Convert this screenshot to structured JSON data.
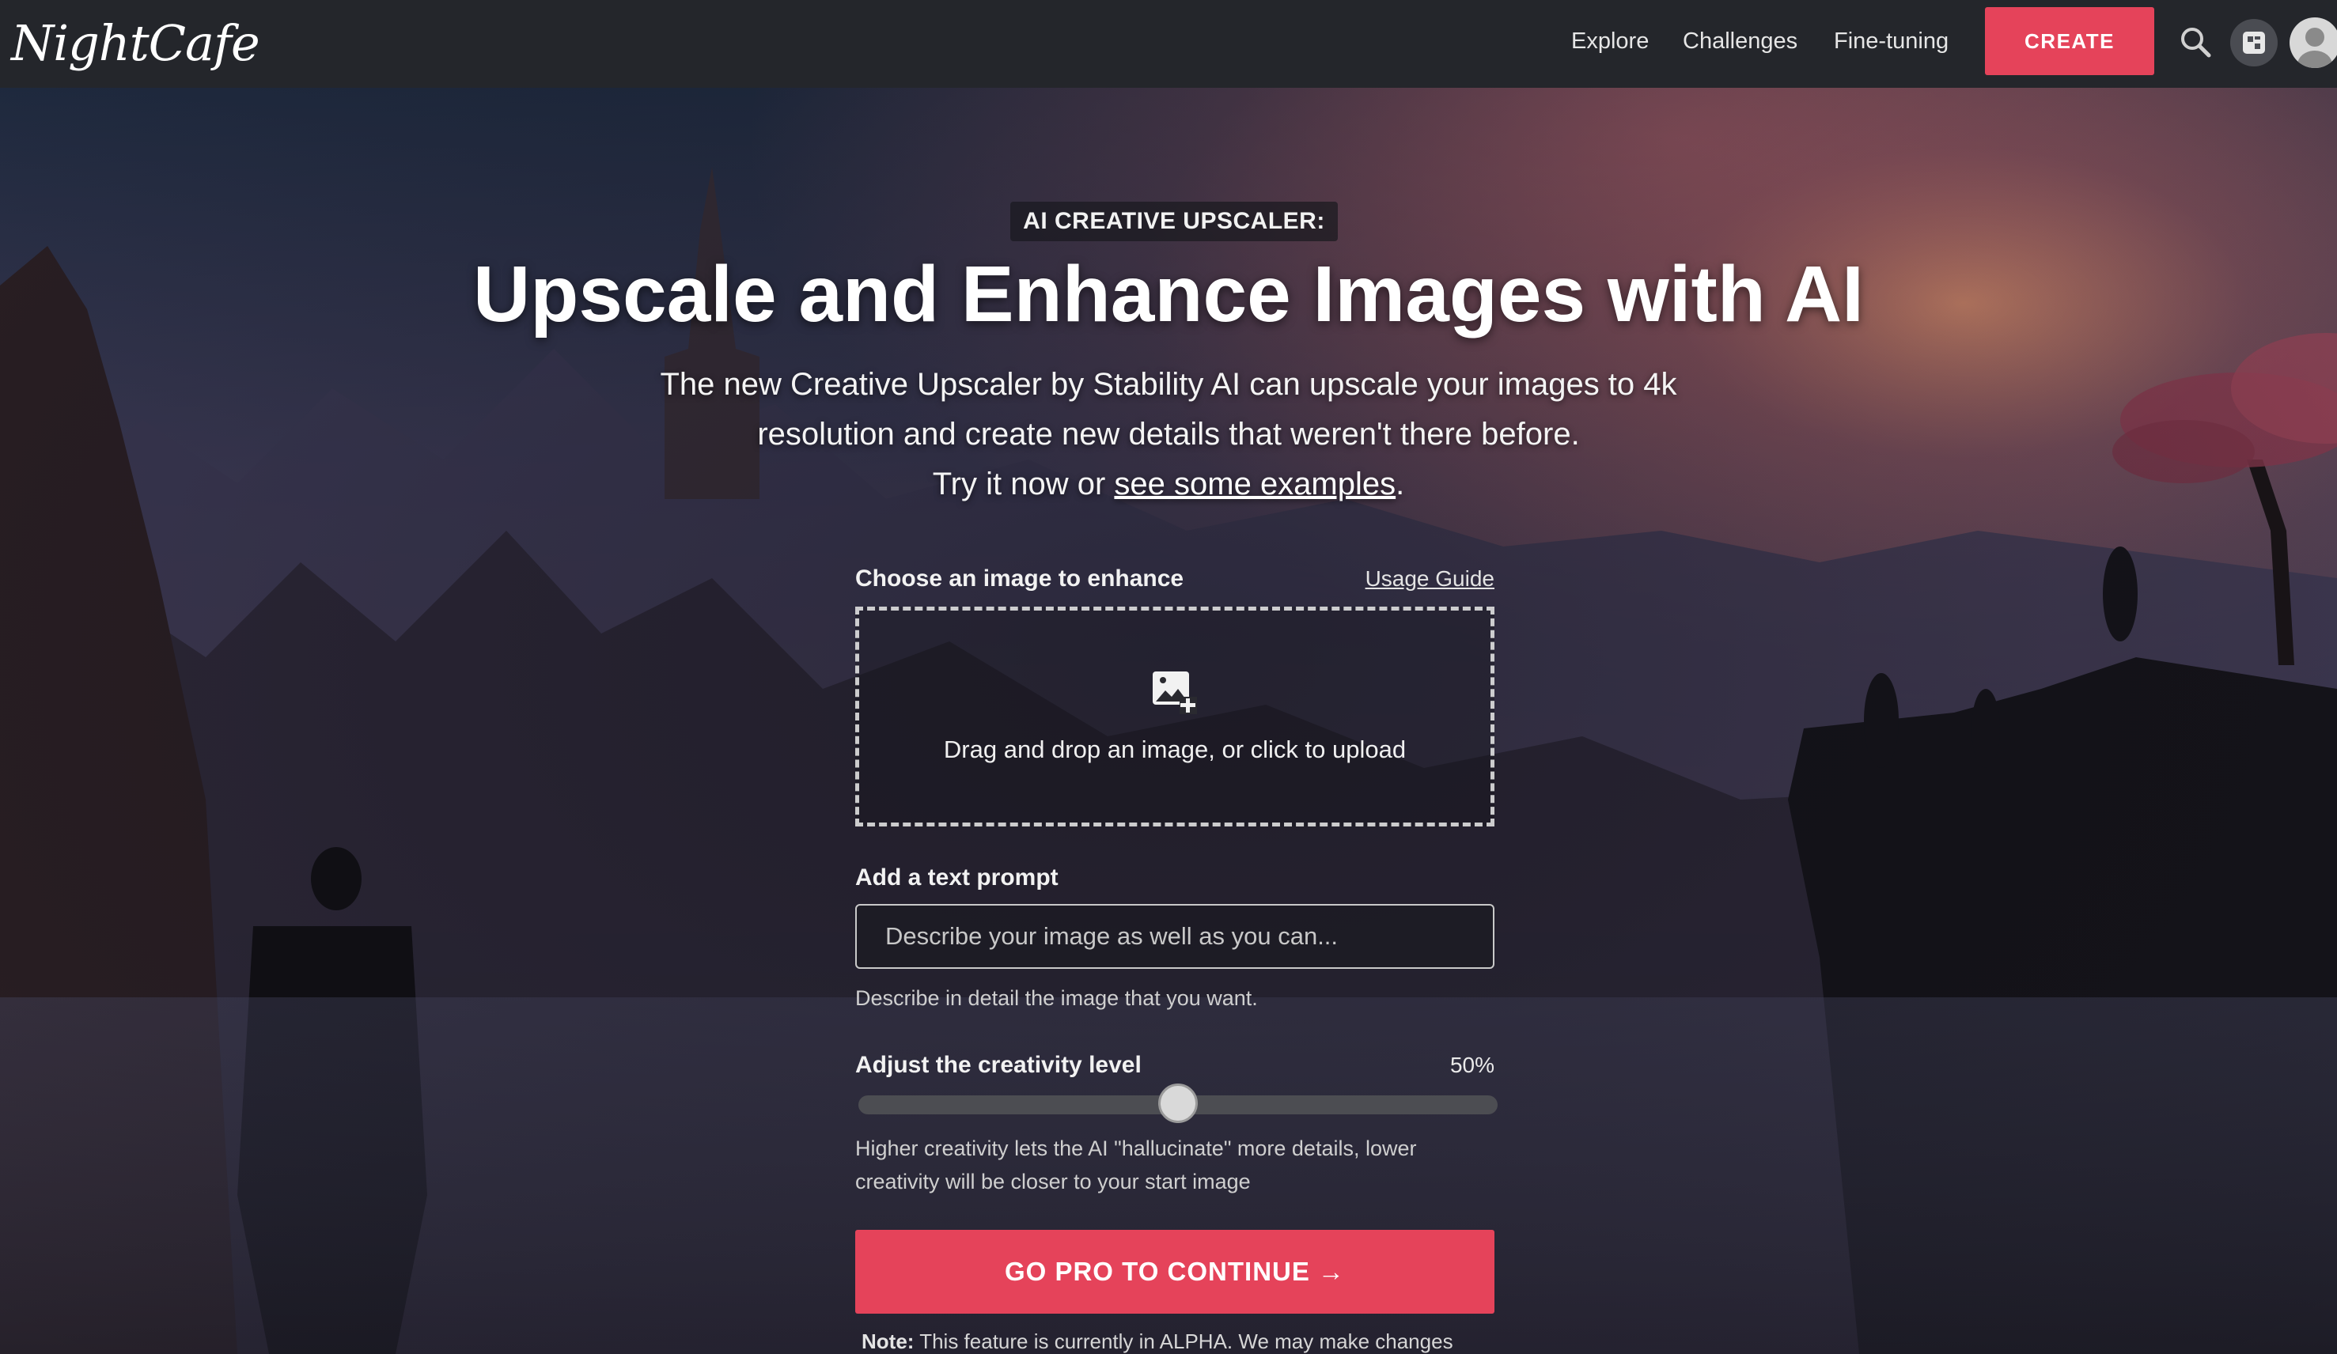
{
  "nav": {
    "logo": "NightCafe",
    "links": [
      "Explore",
      "Challenges",
      "Fine-tuning"
    ],
    "create_label": "CREATE"
  },
  "hero": {
    "eyebrow": "AI CREATIVE UPSCALER:",
    "title": "Upscale and Enhance Images with AI",
    "subtitle_line1": "The new Creative Upscaler by Stability AI can upscale your images to 4k",
    "subtitle_line2": "resolution and create new details that weren't there before.",
    "subtitle_line3_prefix": "Try it now or ",
    "subtitle_link": "see some examples",
    "subtitle_line3_suffix": "."
  },
  "form": {
    "image_label": "Choose an image to enhance",
    "usage_guide": "Usage Guide",
    "dropzone_text": "Drag and drop an image, or click to upload",
    "prompt_label": "Add a text prompt",
    "prompt_placeholder": "Describe your image as well as you can...",
    "prompt_help": "Describe in detail the image that you want.",
    "creativity_label": "Adjust the creativity level",
    "creativity_value": 50,
    "creativity_value_text": "50%",
    "creativity_help": "Higher creativity lets the AI \"hallucinate\" more details, lower creativity will be closer to your start image",
    "submit_label": "GO PRO TO CONTINUE →",
    "note_label": "Note:",
    "note_text": "This feature is currently in ALPHA. We may make changes"
  },
  "colors": {
    "accent": "#e5435a",
    "nav_bg": "#24262b"
  },
  "icons": [
    "search-icon",
    "coins-icon",
    "avatar-icon",
    "add-image-icon"
  ]
}
